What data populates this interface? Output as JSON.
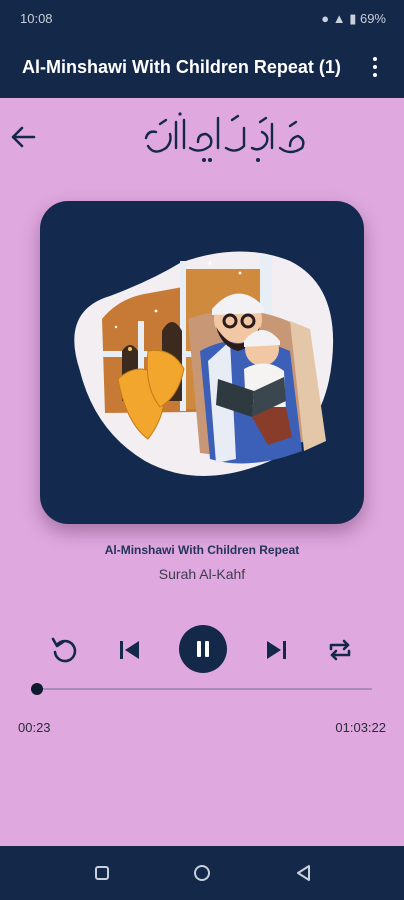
{
  "status_bar": {
    "time": "10:08",
    "indicators": "● ▲ ▮ 69%"
  },
  "app_bar": {
    "title": "Al-Minshawi With Children Repeat (1)",
    "menu_icon": "more-vert-icon"
  },
  "header": {
    "back_icon": "arrow-back-icon",
    "calligraphy": "سُورَةُ الكَهْف"
  },
  "track": {
    "title": "Al-Minshawi With Children Repeat",
    "subtitle": "Surah Al-Kahf"
  },
  "controls": {
    "replay_icon": "replay-icon",
    "previous_icon": "skip-previous-icon",
    "play_pause_icon": "pause-icon",
    "next_icon": "skip-next-icon",
    "repeat_icon": "repeat-icon"
  },
  "progress": {
    "elapsed": "00:23",
    "total": "01:03:22",
    "fraction": 0.006
  },
  "nav_bar": {
    "recent_icon": "recent-apps-icon",
    "home_icon": "home-icon",
    "back_icon": "nav-back-icon"
  },
  "colors": {
    "background": "#dfa8df",
    "primary": "#14284a",
    "artwork_bg": "#132a4e"
  }
}
